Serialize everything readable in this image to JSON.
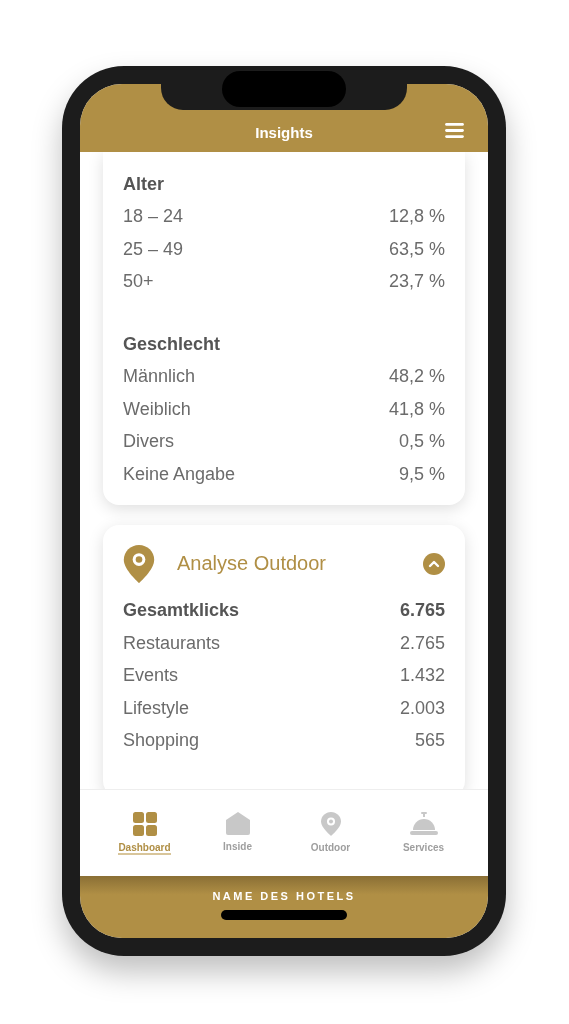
{
  "header": {
    "title": "Insights"
  },
  "cards": [
    {
      "kind": "stats",
      "sections": [
        {
          "heading": "Alter",
          "rows": [
            {
              "label": "18 – 24",
              "value": "12,8 %"
            },
            {
              "label": "25 – 49",
              "value": "63,5 %"
            },
            {
              "label": "50+",
              "value": "23,7 %"
            }
          ]
        },
        {
          "heading": "Geschlecht",
          "rows": [
            {
              "label": "Männlich",
              "value": "48,2 %"
            },
            {
              "label": "Weiblich",
              "value": "41,8 %"
            },
            {
              "label": "Divers",
              "value": "0,5 %"
            },
            {
              "label": "Keine Angabe",
              "value": "9,5 %"
            }
          ]
        }
      ]
    },
    {
      "kind": "collapsible",
      "title": "Analyse Outdoor",
      "expanded": true,
      "total": {
        "label": "Gesamtklicks",
        "value": "6.765"
      },
      "rows": [
        {
          "label": "Restaurants",
          "value": "2.765"
        },
        {
          "label": "Events",
          "value": "1.432"
        },
        {
          "label": "Lifestyle",
          "value": "2.003"
        },
        {
          "label": "Shopping",
          "value": "565"
        }
      ]
    }
  ],
  "tabs": [
    {
      "label": "Dashboard",
      "kind": "grid",
      "selected": true
    },
    {
      "label": "Inside",
      "kind": "house",
      "selected": false
    },
    {
      "label": "Outdoor",
      "kind": "pin",
      "selected": false
    },
    {
      "label": "Services",
      "kind": "bell",
      "selected": false
    }
  ],
  "footer": {
    "hotel_name": "NAME DES HOTELS"
  }
}
